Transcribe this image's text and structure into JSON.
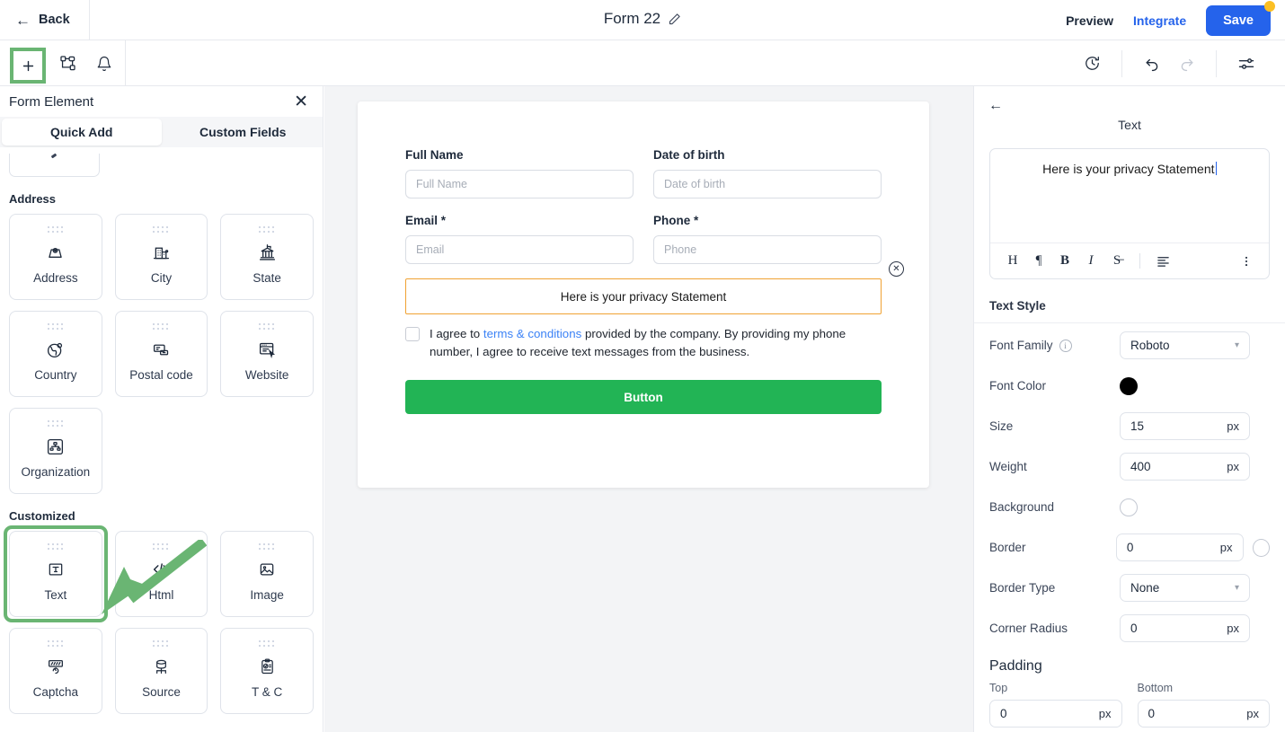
{
  "header": {
    "back_label": "Back",
    "title": "Form 22",
    "edit_icon": "pencil-icon",
    "preview_label": "Preview",
    "integrate_label": "Integrate",
    "save_label": "Save",
    "save_badge_color": "#fbbf24",
    "accent_color": "#2563eb"
  },
  "toolbar": {
    "add_icon": "plus-icon",
    "components_icon": "components-icon",
    "notifications_icon": "bell-icon",
    "history_icon": "history-clock-icon",
    "undo_icon": "undo-icon",
    "redo_icon": "redo-icon",
    "settings_icon": "sliders-icon",
    "highlight_color": "#6ab573"
  },
  "left_panel": {
    "title": "Form Element",
    "close_icon": "close-icon",
    "tabs": [
      {
        "label": "Quick Add",
        "active": true
      },
      {
        "label": "Custom Fields",
        "active": false
      }
    ],
    "groups": [
      {
        "label": "Address",
        "items": [
          {
            "label": "Address",
            "icon": "address-pin-icon"
          },
          {
            "label": "City",
            "icon": "city-building-icon"
          },
          {
            "label": "State",
            "icon": "state-bank-icon"
          },
          {
            "label": "Country",
            "icon": "globe-icon"
          },
          {
            "label": "Postal code",
            "icon": "postal-code-icon"
          },
          {
            "label": "Website",
            "icon": "website-cursor-icon"
          },
          {
            "label": "Organization",
            "icon": "organization-chart-icon"
          }
        ]
      },
      {
        "label": "Customized",
        "items": [
          {
            "label": "Text",
            "icon": "text-box-icon",
            "highlighted": true
          },
          {
            "label": "Html",
            "icon": "code-icon"
          },
          {
            "label": "Image",
            "icon": "image-icon"
          },
          {
            "label": "Captcha",
            "icon": "captcha-icon"
          },
          {
            "label": "Source",
            "icon": "source-database-icon"
          },
          {
            "label": "T & C",
            "icon": "terms-clipboard-icon"
          }
        ]
      }
    ],
    "annotation_arrow_color": "#6ab573"
  },
  "form_canvas": {
    "fields": [
      {
        "label": "Full Name",
        "placeholder": "Full Name",
        "required": false
      },
      {
        "label": "Date of birth",
        "placeholder": "Date of birth",
        "required": false
      },
      {
        "label": "Email *",
        "placeholder": "Email",
        "required": true
      },
      {
        "label": "Phone *",
        "placeholder": "Phone",
        "required": true
      }
    ],
    "text_block": {
      "value": "Here is your privacy Statement",
      "selected_border_color": "#f0a233",
      "remove_icon": "remove-circle-icon"
    },
    "consent": {
      "prefix": "I agree to ",
      "link": "terms & conditions",
      "suffix": " provided by the company. By providing my phone number, I agree to receive text messages from the business.",
      "checked": false
    },
    "submit": {
      "label": "Button",
      "color": "#22b455"
    }
  },
  "right_panel": {
    "back_icon": "back-arrow-icon",
    "title": "Text",
    "editor_value": "Here is your privacy Statement",
    "editor_toolbar": [
      {
        "glyph": "H",
        "name": "heading-icon",
        "bold": false
      },
      {
        "glyph": "¶",
        "name": "paragraph-icon",
        "bold": false
      },
      {
        "glyph": "B",
        "name": "bold-icon",
        "bold": true
      },
      {
        "glyph": "I",
        "name": "italic-icon",
        "bold": false
      },
      {
        "glyph": "S̶",
        "name": "strikethrough-icon",
        "bold": false
      }
    ],
    "align_icon": "align-left-icon",
    "more_icon": "more-vertical-icon",
    "section_label": "Text Style",
    "rows": [
      {
        "label": "Font Family",
        "type": "select",
        "value": "Roboto",
        "info": true
      },
      {
        "label": "Font Color",
        "type": "swatch",
        "value": "#000000"
      },
      {
        "label": "Size",
        "type": "number",
        "value": "15",
        "unit": "px"
      },
      {
        "label": "Weight",
        "type": "number",
        "value": "400",
        "unit": "px"
      },
      {
        "label": "Background",
        "type": "swatch",
        "value": "#ffffff"
      },
      {
        "label": "Border",
        "type": "number_swatch",
        "value": "0",
        "unit": "px",
        "swatch": "#ffffff"
      },
      {
        "label": "Border Type",
        "type": "select",
        "value": "None"
      },
      {
        "label": "Corner Radius",
        "type": "number",
        "value": "0",
        "unit": "px"
      }
    ],
    "padding": {
      "title": "Padding",
      "top_label": "Top",
      "top_value": "0",
      "bottom_label": "Bottom",
      "bottom_value": "0",
      "unit": "px"
    }
  }
}
